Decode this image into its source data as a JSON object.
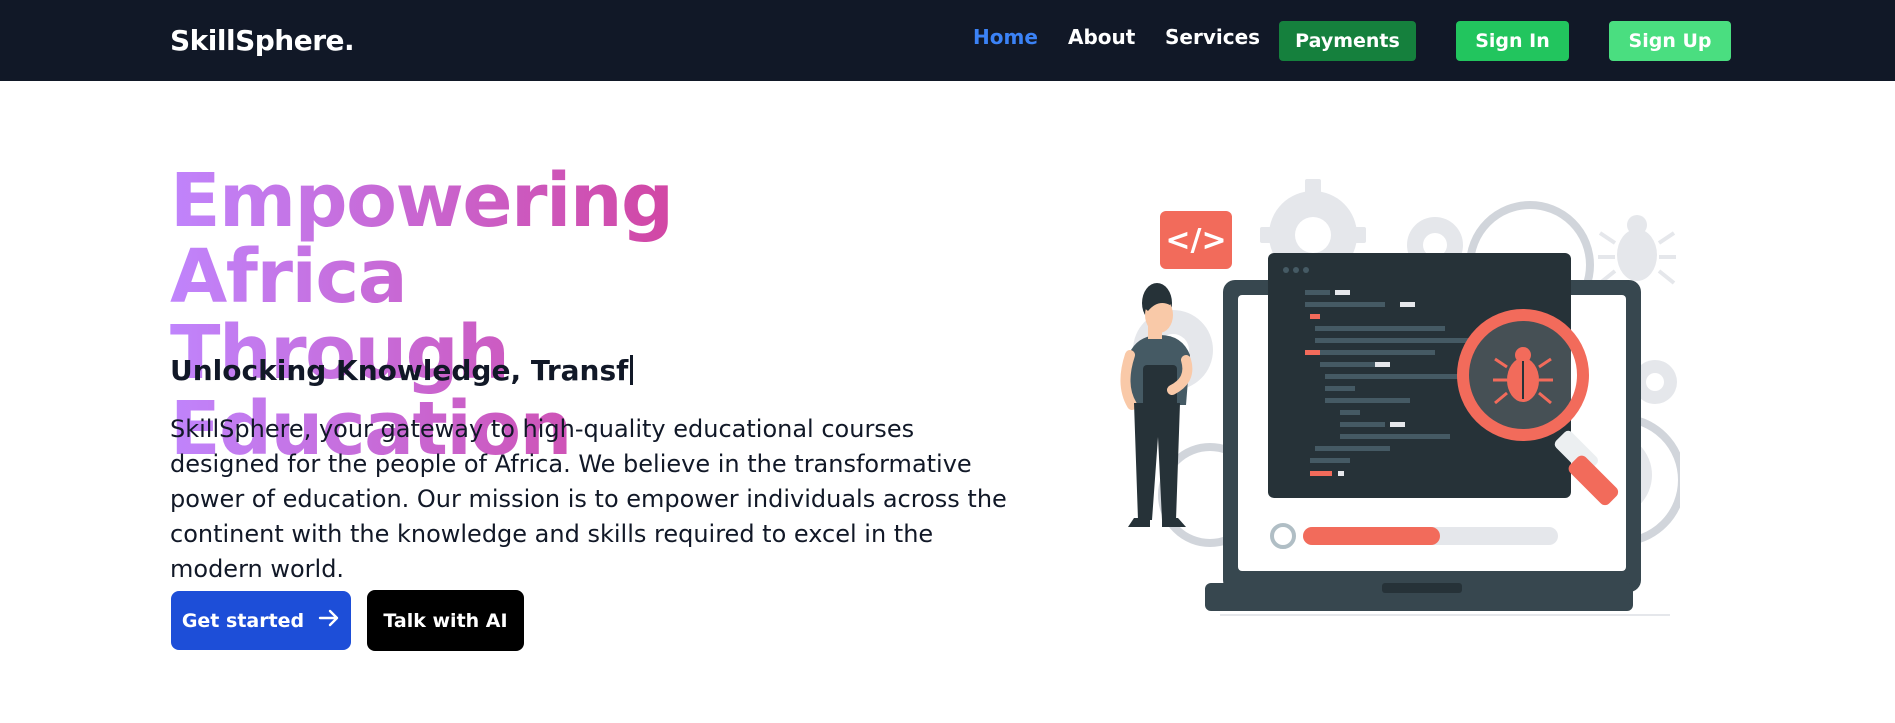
{
  "nav": {
    "brand": "SkillSphere.",
    "links": [
      "Home",
      "About",
      "Services"
    ],
    "buttons": {
      "payments": "Payments",
      "sign_in": "Sign In",
      "sign_up": "Sign Up"
    }
  },
  "hero": {
    "title_line1": "Empowering Africa",
    "title_line2": "Through Education",
    "typewriter": "Unlocking Knowledge, Transf",
    "description": "SkillSphere, your gateway to high-quality educational courses designed for the people of Africa. We believe in the transformative power of education. Our mission is to empower individuals across the continent with the knowledge and skills required to excel in the modern world.",
    "primary_cta": "Get started",
    "secondary_cta": "Talk with AI"
  },
  "illustration": {
    "code_tag": "</>",
    "icons": [
      "code-tag-icon",
      "bug-icon",
      "magnifier-icon",
      "gear-icon",
      "laptop-icon",
      "person-icon"
    ]
  },
  "colors": {
    "nav_bg": "#111827",
    "active_link": "#3b82f6",
    "payments": "#15803d",
    "sign_in": "#22c55e",
    "sign_up": "#4ade80",
    "primary": "#1d4ed8",
    "accent_red": "#f26b5b"
  }
}
